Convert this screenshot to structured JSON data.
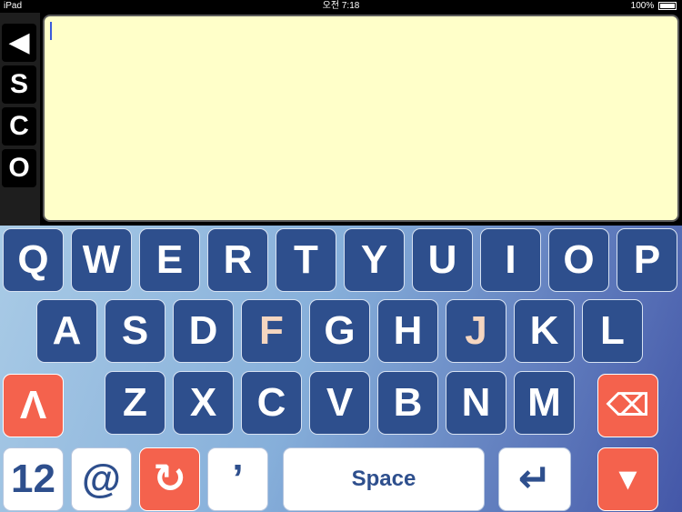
{
  "status_bar": {
    "device": "iPad",
    "time": "오전 7:18",
    "battery": "100%"
  },
  "sidebar": {
    "back_label": "◀",
    "s_label": "S",
    "c_label": "C",
    "o_label": "O"
  },
  "text_area": {
    "value": ""
  },
  "keyboard": {
    "row1": [
      "Q",
      "W",
      "E",
      "R",
      "T",
      "Y",
      "U",
      "I",
      "O",
      "P"
    ],
    "row2": [
      "A",
      "S",
      "D",
      "F",
      "G",
      "H",
      "J",
      "K",
      "L"
    ],
    "row3": [
      "Z",
      "X",
      "C",
      "V",
      "B",
      "N",
      "M"
    ],
    "shift_label": "Λ",
    "backspace_label": "⌫",
    "numbers_label": "12",
    "at_label": "@",
    "redo_label": "↻",
    "apostrophe_label": "’",
    "space_label": "Space",
    "return_label": "↵",
    "hide_label": "▼"
  },
  "colors": {
    "key": "#2e4f8d",
    "red": "#f4624d",
    "accent": "#f5d6c0",
    "textarea": "#ffffc9"
  }
}
